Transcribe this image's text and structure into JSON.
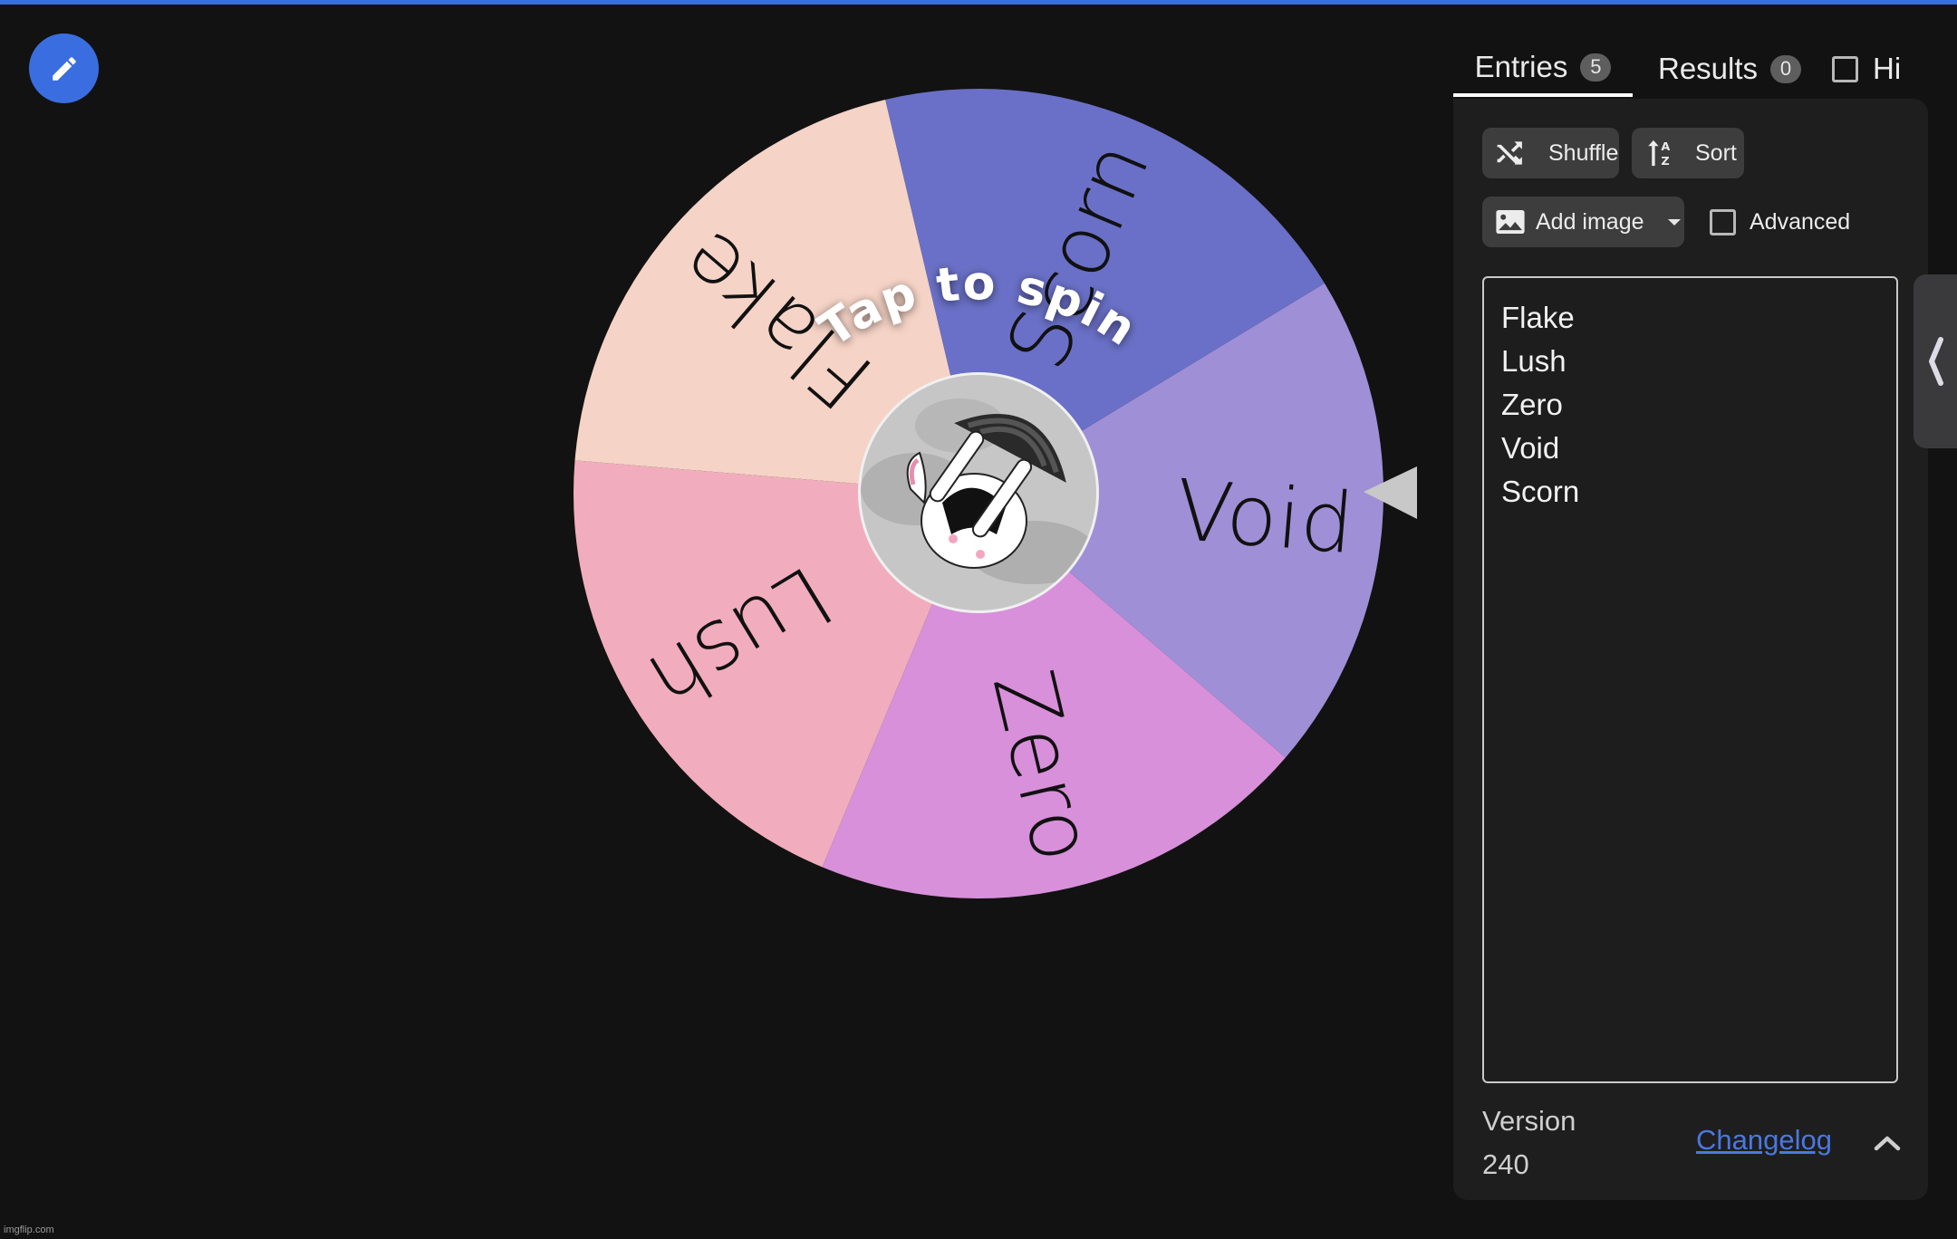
{
  "colors": {
    "accent": "#3a6ee0",
    "background": "#121212",
    "panel": "#1e1e1e",
    "pointer": "#c8c8c8",
    "link": "#4a78e0"
  },
  "fab": {
    "icon": "pencil-icon"
  },
  "wheel": {
    "center_prompt": "Tap to spin",
    "rotation_deg": 4.7,
    "center_image": "bunny-with-umbrella-illustration",
    "slices": [
      {
        "label": "Void",
        "color": "#9f8fd6"
      },
      {
        "label": "Zero",
        "color": "#d890da"
      },
      {
        "label": "Lush",
        "color": "#f1adbd"
      },
      {
        "label": "Flake",
        "color": "#f5d3c6"
      },
      {
        "label": "Scorn",
        "color": "#6a70c7"
      }
    ],
    "pointer_icon": "triangle-pointer-icon"
  },
  "tabs": {
    "entries": {
      "label": "Entries",
      "count": "5",
      "active": true
    },
    "results": {
      "label": "Results",
      "count": "0",
      "active": false
    },
    "hide": {
      "label": "Hide",
      "visible_text": "Hi",
      "checked": false
    }
  },
  "toolbar": {
    "shuffle_label": "Shuffle",
    "sort_label": "Sort",
    "add_image_label": "Add image",
    "advanced_label": "Advanced",
    "advanced_checked": false
  },
  "entries": [
    "Flake",
    "Lush",
    "Zero",
    "Void",
    "Scorn"
  ],
  "footer": {
    "version_label": "Version",
    "version_number": "240",
    "changelog_label": "Changelog"
  },
  "watermark": "imgflip.com"
}
